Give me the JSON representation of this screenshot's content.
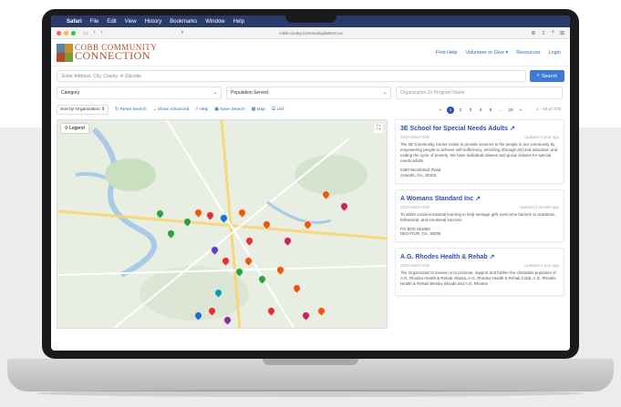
{
  "menubar": {
    "apple": "",
    "app": "Safari",
    "items": [
      "File",
      "Edit",
      "View",
      "History",
      "Bookmarks",
      "Window",
      "Help"
    ]
  },
  "browser": {
    "url": "cobb-county.communityplatform.us",
    "traffic_colors": [
      "#ff5f57",
      "#febc2e",
      "#28c840"
    ]
  },
  "site": {
    "logo_line1": "COBB COMMUNITY",
    "logo_line2": "CONNECTION",
    "nav": [
      "Find Help",
      "Volunteer or Give",
      "Resources",
      "Login"
    ]
  },
  "search": {
    "address_placeholder": "Enter Address, City, County, or Zipcode",
    "button_label": "Search",
    "category_label": "Category",
    "population_label": "Population Served",
    "org_placeholder": "Organization Or Program Name"
  },
  "controls": {
    "sort_label": "Sort by Organization",
    "reset": "Reset Search",
    "advanced": "Show Advanced",
    "help": "Help",
    "save": "Save Search",
    "map": "Map",
    "list": "List",
    "pages": [
      "«",
      "1",
      "2",
      "3",
      "4",
      "5",
      "...",
      "10",
      "»"
    ],
    "count": "1 - 40 of 375"
  },
  "map": {
    "legend": "Legend"
  },
  "results": [
    {
      "title": "3E School for Special Needs Adults",
      "type": "ORGANIZATION",
      "updated": "Updated 1 year ago",
      "desc": "The 3E Community Center exists to provide services to the people in our community by empowering people to achieve self-sufficiency, enriching (through art) and education and ending the cycle of poverty. We have individual classes and group classes for special needs adults.",
      "addr1": "5360 Woodstock Road",
      "addr2": "Acworth, GA, 30102"
    },
    {
      "title": "A Womans Standard Inc",
      "type": "ORGANIZATION",
      "updated": "Updated 2 months ago",
      "desc": "To utilize social-emotional learning to help teenage girls overcome barriers to academic, behavioral, and emotional success.",
      "addr1": "PO BOX 361850",
      "addr2": "DECATUR, GA, 30036"
    },
    {
      "title": "A.G. Rhodes Health & Rehab",
      "type": "ORGANIZATION",
      "updated": "Updated 1 year ago",
      "desc": "The Organization's mission is to promote, support and further the charitable purposes of A.G. Rhodes Health & Rehab Atlanta, A.G. Rhodes Health & Rehab Cobb, A.G. Rhodes Health & Rehab Wesley Woods and A.G. Rhodes",
      "addr1": "",
      "addr2": ""
    }
  ]
}
